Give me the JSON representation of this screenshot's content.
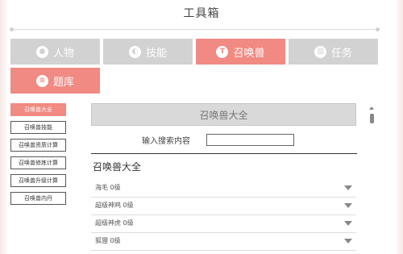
{
  "header": {
    "title": "工具箱"
  },
  "tabs": [
    {
      "label": "人物",
      "icon": "person-icon",
      "glyph": "●",
      "active": false
    },
    {
      "label": "技能",
      "icon": "skill-icon",
      "glyph": "◐",
      "active": false
    },
    {
      "label": "召唤兽",
      "icon": "summon-icon",
      "glyph": "T",
      "active": true
    },
    {
      "label": "任务",
      "icon": "task-icon",
      "glyph": "▥",
      "active": false
    },
    {
      "label": "题库",
      "icon": "quiz-icon",
      "glyph": "≡",
      "active": true
    }
  ],
  "sidebar": {
    "items": [
      {
        "label": "召唤兽大全",
        "active": true
      },
      {
        "label": "召唤兽技能",
        "active": false
      },
      {
        "label": "召唤兽资质计算",
        "active": false
      },
      {
        "label": "召唤兽修炼计算",
        "active": false
      },
      {
        "label": "召唤兽升级计算",
        "active": false
      },
      {
        "label": "召唤兽内丹",
        "active": false
      }
    ]
  },
  "main": {
    "header": "召唤兽大全",
    "search_label": "输入搜索内容",
    "search_placeholder": "",
    "section_title": "召唤兽大全",
    "rows": [
      {
        "label": "海毛 0级"
      },
      {
        "label": "超级神鸡 0级"
      },
      {
        "label": "超级神虎 0级"
      },
      {
        "label": "狐狸 0级"
      }
    ]
  },
  "colors": {
    "accent": "#f08a82",
    "inactive": "#d2d2d2"
  }
}
